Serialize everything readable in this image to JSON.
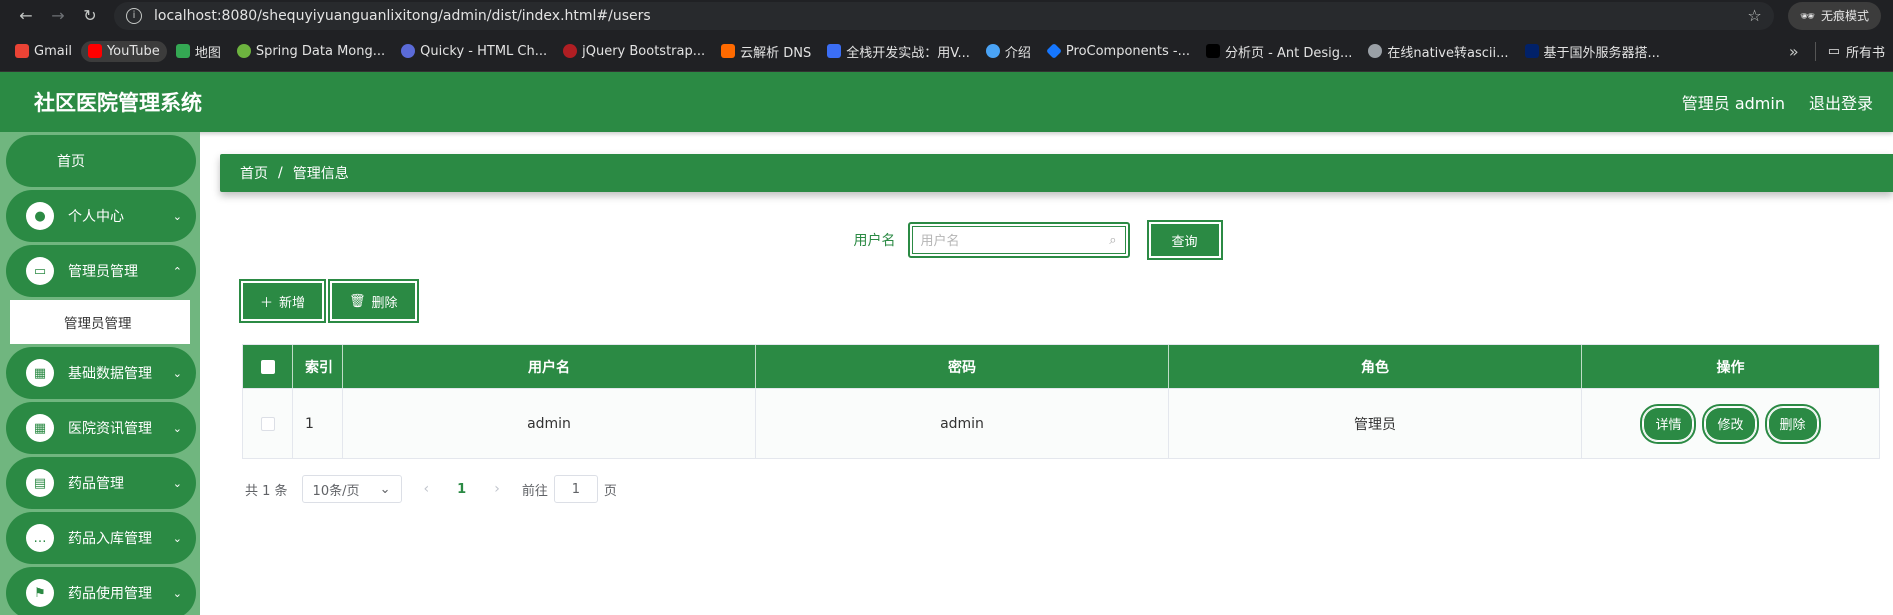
{
  "browser": {
    "url": "localhost:8080/shequyiyuanguanlixitong/admin/dist/index.html#/users",
    "incognito_label": "无痕模式",
    "bookmarks": [
      {
        "label": "Gmail",
        "color": "#ea4335"
      },
      {
        "label": "YouTube",
        "color": "#ff0000"
      },
      {
        "label": "地图",
        "color": "#34a853"
      },
      {
        "label": "Spring Data Mong...",
        "color": "#6db33f"
      },
      {
        "label": "Quicky - HTML Ch...",
        "color": "#5b6bd8"
      },
      {
        "label": "jQuery Bootstrap...",
        "color": "#b01e23"
      },
      {
        "label": "云解析 DNS",
        "color": "#ff6a00"
      },
      {
        "label": "全栈开发实战：用V...",
        "color": "#3b6ef5"
      },
      {
        "label": "介绍",
        "color": "#4aa3f5"
      },
      {
        "label": "ProComponents -...",
        "color": "#1677ff"
      },
      {
        "label": "分析页 - Ant Desig...",
        "color": "#000000"
      },
      {
        "label": "在线native转ascii...",
        "color": "#9aa0a6"
      },
      {
        "label": "基于国外服务器搭...",
        "color": "#012169"
      }
    ],
    "all_bookmarks_label": "所有书"
  },
  "header": {
    "title": "社区医院管理系统",
    "user": "管理员 admin",
    "logout": "退出登录"
  },
  "sidebar": {
    "home": "首页",
    "items": [
      {
        "label": "个人中心",
        "icon": "user-icon"
      },
      {
        "label": "管理员管理",
        "icon": "monitor-icon"
      },
      {
        "label": "基础数据管理",
        "icon": "grid-icon"
      },
      {
        "label": "医院资讯管理",
        "icon": "grid-icon"
      },
      {
        "label": "药品管理",
        "icon": "clipboard-icon"
      },
      {
        "label": "药品入库管理",
        "icon": "chat-icon"
      },
      {
        "label": "药品使用管理",
        "icon": "flag-icon"
      }
    ],
    "sub_item": "管理员管理"
  },
  "breadcrumb": {
    "home": "首页",
    "sep": "/",
    "current": "管理信息"
  },
  "search": {
    "label": "用户名",
    "placeholder": "用户名",
    "button": "查询"
  },
  "toolbar": {
    "add": "新增",
    "delete": "删除"
  },
  "table": {
    "headers": [
      "索引",
      "用户名",
      "密码",
      "角色",
      "操作"
    ],
    "rows": [
      {
        "index": "1",
        "username": "admin",
        "password": "admin",
        "role": "管理员"
      }
    ],
    "ops": {
      "detail": "详情",
      "edit": "修改",
      "delete": "删除"
    }
  },
  "pager": {
    "total": "共 1 条",
    "page_size": "10条/页",
    "current": "1",
    "goto_prefix": "前往",
    "goto_value": "1",
    "goto_suffix": "页"
  },
  "colors": {
    "primary": "#2b8a44",
    "sidebar_bg": "#70b67f"
  }
}
